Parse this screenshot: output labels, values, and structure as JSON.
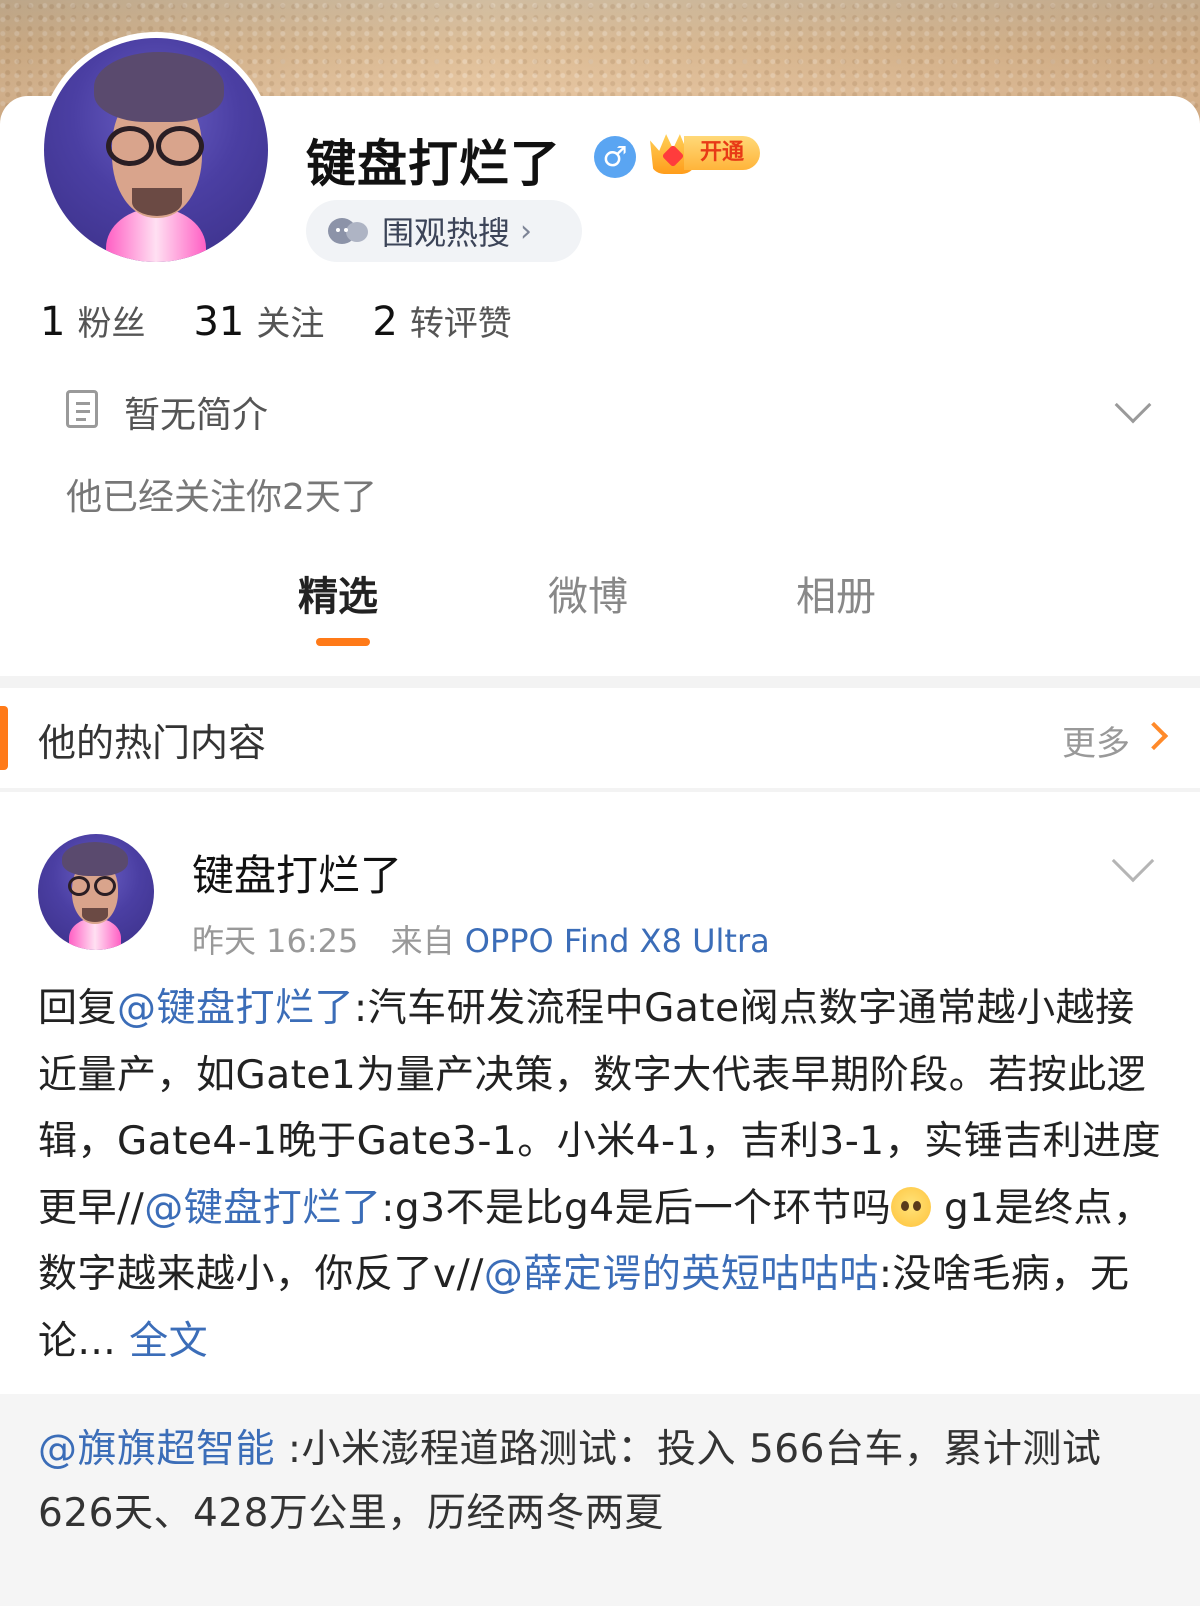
{
  "profile": {
    "username": "键盘打烂了",
    "gender_symbol": "♂",
    "vip_label": "开通",
    "hot_search_label": "围观热搜",
    "stats": [
      {
        "value": "1",
        "label": "粉丝"
      },
      {
        "value": "31",
        "label": "关注"
      },
      {
        "value": "2",
        "label": "转评赞"
      }
    ],
    "bio": "暂无简介",
    "follow_note": "他已经关注你2天了"
  },
  "tabs": [
    {
      "label": "精选",
      "active": true
    },
    {
      "label": "微博",
      "active": false
    },
    {
      "label": "相册",
      "active": false
    }
  ],
  "section": {
    "title": "他的热门内容",
    "more_label": "更多"
  },
  "post": {
    "author": "键盘打烂了",
    "time": "昨天 16:25",
    "source_prefix": "来自",
    "device": "OPPO Find X8 Ultra",
    "body": {
      "prefix": "回复",
      "mention1": "@键盘打烂了",
      "text1": ":汽车研发流程中Gate阀点数字通常越小越接近量产，如Gate1为量产决策，数字大代表早期阶段。若按此逻辑，Gate4-1晚于Gate3-1。小米4-1，吉利3-1，实锤吉利进度更早//",
      "mention2": "@键盘打烂了",
      "text2": ":g3不是比g4是后一个环节吗",
      "text3": " g1是终点，数字越来越小，你反了v//",
      "mention3": "@薛定谔的英短咕咕咕",
      "text4": ":没啥毛病，无论... ",
      "full_text_label": "全文"
    },
    "emoji": "pleading-face-icon"
  },
  "repost": {
    "mention": "@旗旗超智能",
    "text": " :小米澎程道路测试：投入 566台车，累计测试626天、428万公里，历经两冬两夏"
  },
  "colors": {
    "accent": "#ff7a18",
    "link": "#3b6db8",
    "gender_badge": "#5aa5f2"
  }
}
